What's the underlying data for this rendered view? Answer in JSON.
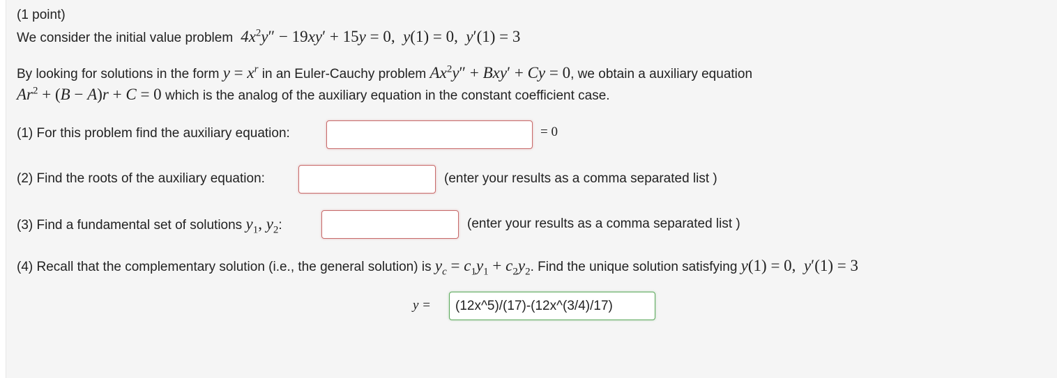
{
  "header": {
    "points": "(1 point)"
  },
  "intro": {
    "text": "We consider the initial value problem",
    "equation": "4x²y″ − 19xy′ + 15y = 0,  y(1) = 0,  y′(1) = 3"
  },
  "explanation": {
    "line1_a": "By looking for solutions in the form",
    "line1_b": "in an Euler-Cauchy problem",
    "line1_c": ", we obtain a auxiliary equation",
    "line2_b": "which is the analog of the auxiliary equation in the constant coefficient case."
  },
  "q1": {
    "label": "(1) For this problem find the auxiliary equation:",
    "suffix": "= 0",
    "value": ""
  },
  "q2": {
    "label": "(2) Find the roots of the auxiliary equation:",
    "hint": "(enter your results as a comma separated list )",
    "value": ""
  },
  "q3": {
    "label": "(3) Find a fundamental set of solutions",
    "hint": "(enter your results as a comma separated list )",
    "value": ""
  },
  "q4": {
    "label_a": "(4) Recall that the complementary solution (i.e., the general solution) is",
    "label_b": ". Find the unique solution satisfying",
    "answer_prefix": "y =",
    "value": "(12x^5)/(17)-(12x^(3/4)/17)"
  }
}
